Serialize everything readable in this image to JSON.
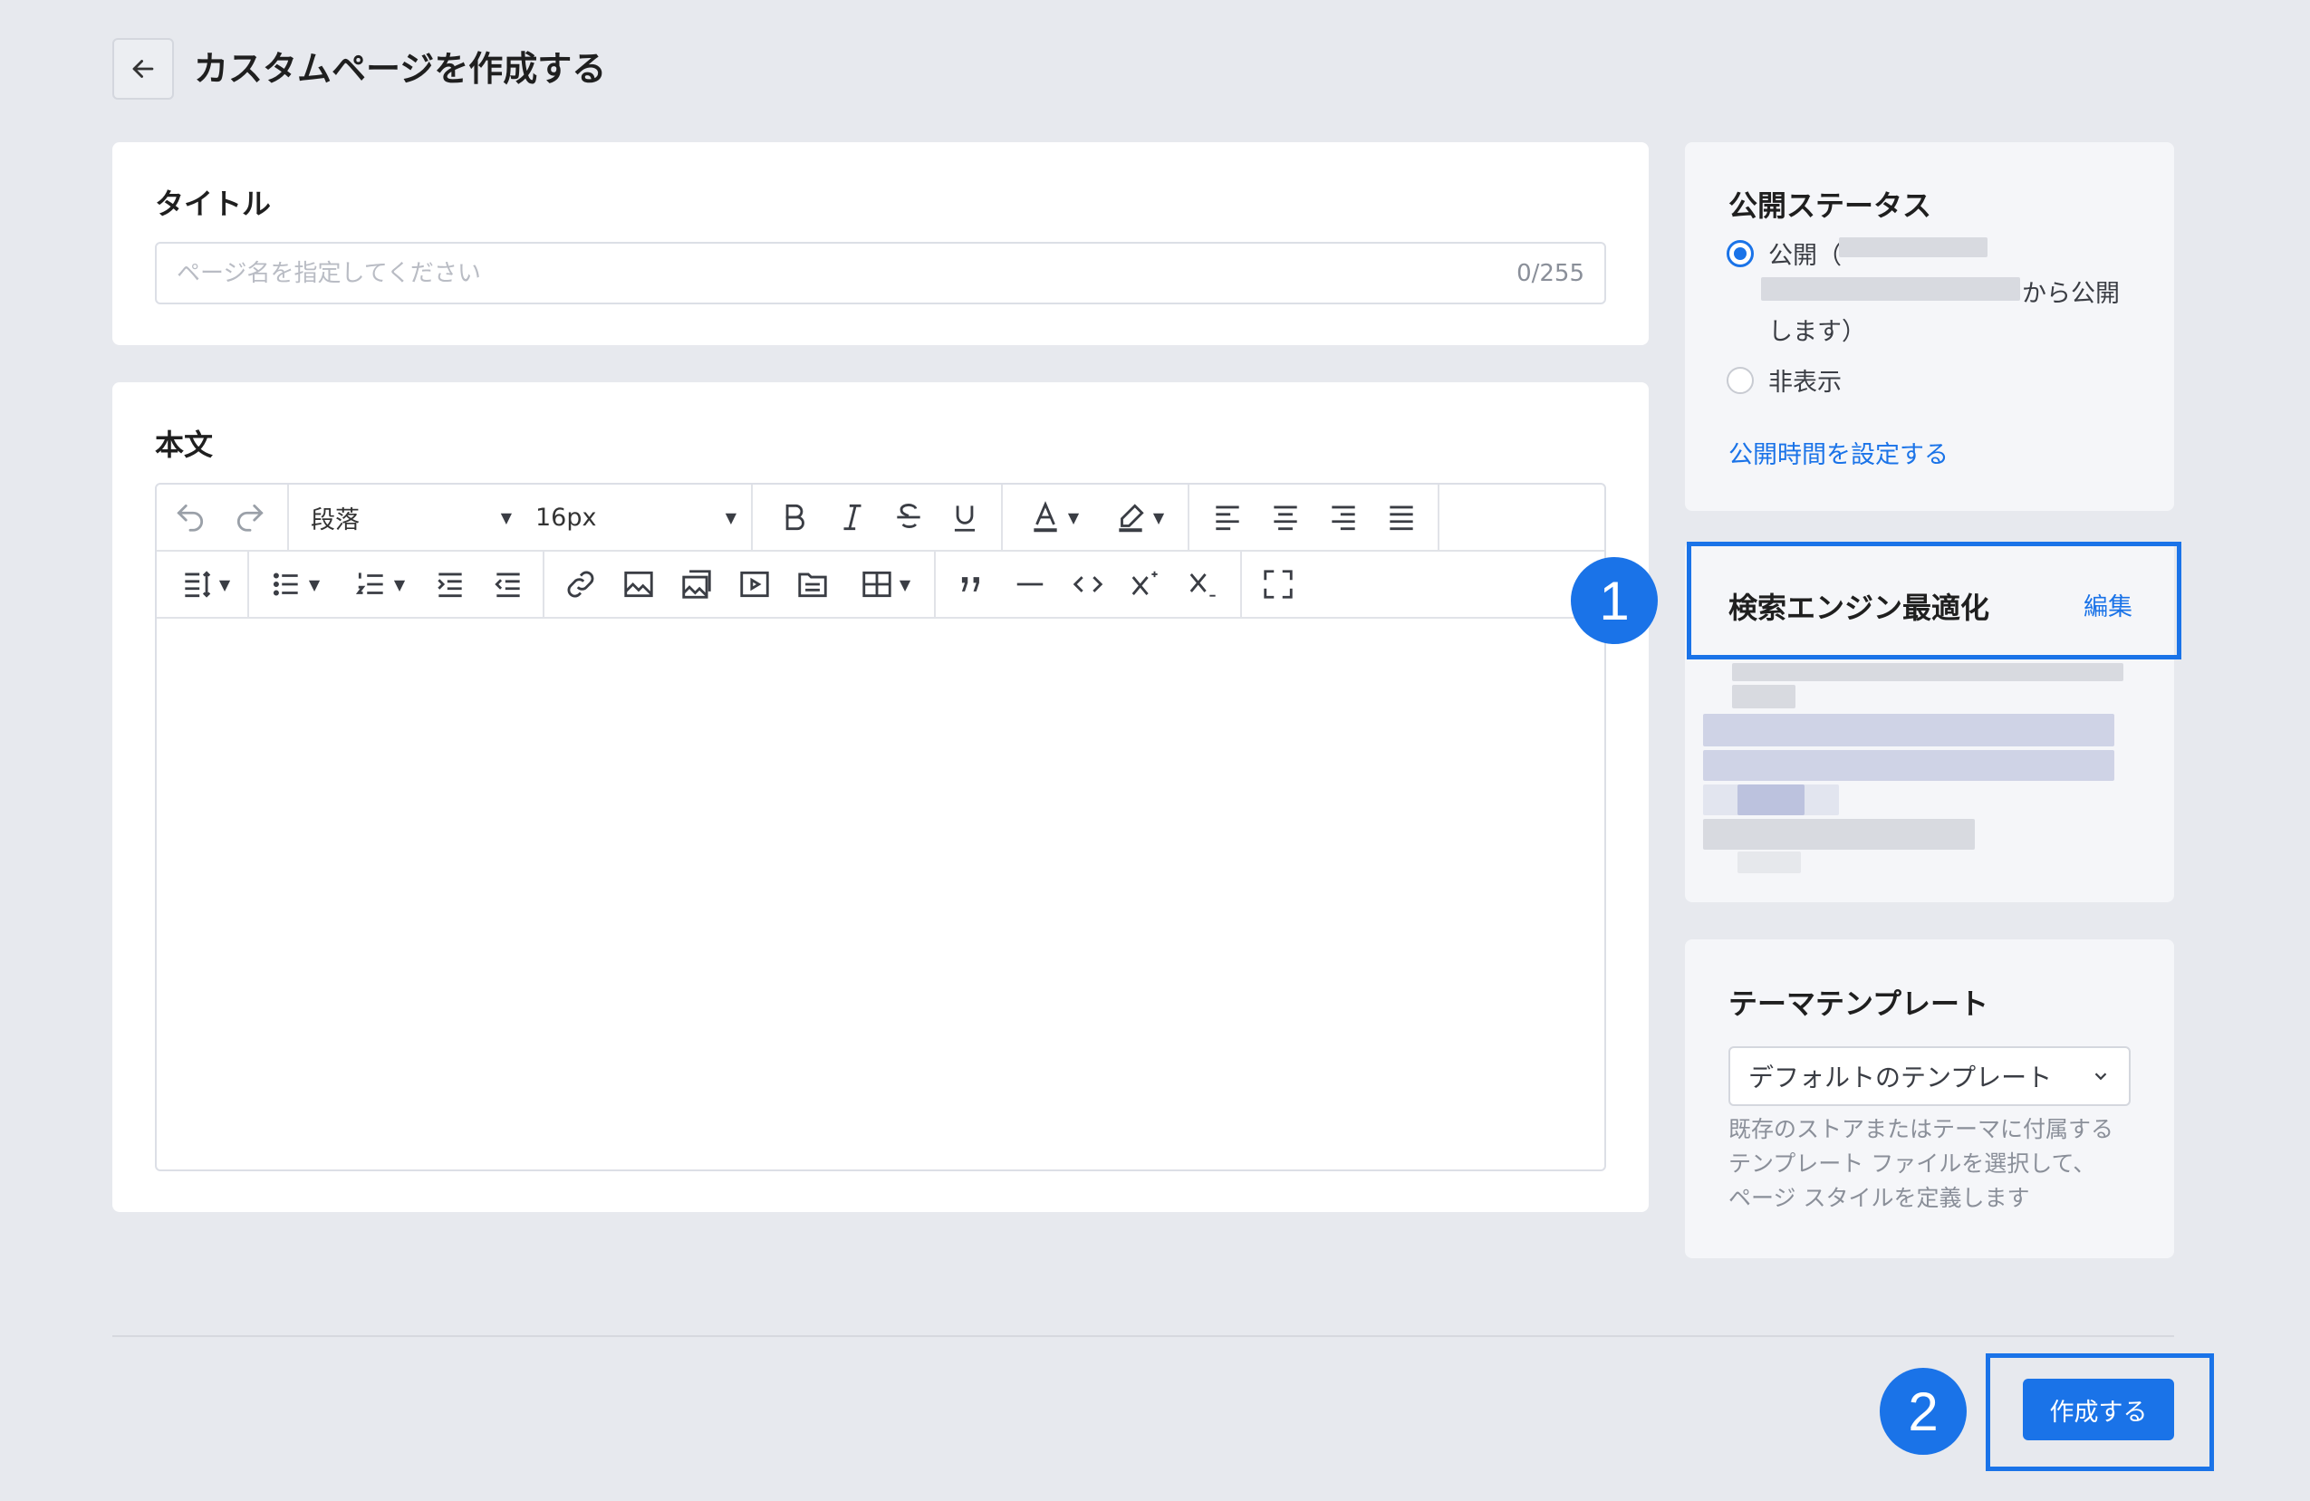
{
  "header": {
    "title": "カスタムページを作成する"
  },
  "title_card": {
    "label": "タイトル",
    "placeholder": "ページ名を指定してください",
    "value": "",
    "char_count": "0/255"
  },
  "body_card": {
    "label": "本文",
    "paragraph_select": "段落",
    "font_size_select": "16px"
  },
  "status_card": {
    "label": "公開ステータス",
    "public_option_prefix": "公開（",
    "public_option_suffix": "から公開",
    "public_option_end": "します）",
    "hidden_option": "非表示",
    "set_time_link": "公開時間を設定する",
    "selected": "public"
  },
  "seo_card": {
    "label": "検索エンジン最適化",
    "edit_link": "編集"
  },
  "template_card": {
    "label": "テーマテンプレート",
    "selected": "デフォルトのテンプレート",
    "helper": "既存のストアまたはテーマに付属するテンプレート ファイルを選択して、ページ スタイルを定義します"
  },
  "footer": {
    "create_button": "作成する"
  },
  "annotations": {
    "badge1": "1",
    "badge2": "2"
  },
  "colors": {
    "accent": "#1a73e8",
    "background": "#e7e9ee"
  }
}
